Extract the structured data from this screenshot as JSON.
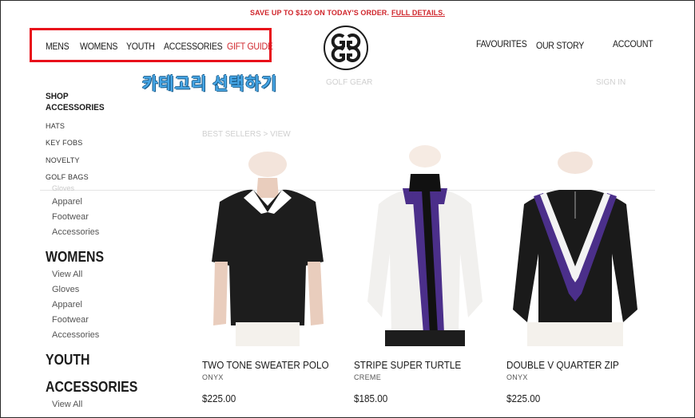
{
  "promo": {
    "text": "SAVE UP TO $120 ON TODAY'S ORDER.",
    "link": "FULL DETAILS."
  },
  "nav": {
    "left": [
      "MENS",
      "WOMENS",
      "YOUTH",
      "ACCESSORIES",
      "GIFT GUIDE"
    ],
    "right": [
      "FAVOURITES",
      "OUR STORY",
      "ACCOUNT"
    ]
  },
  "logo": {
    "icon": "brand-logo-icon"
  },
  "annotation": "카테고리 선택하기",
  "faded": {
    "center": "GOLF GEAR",
    "right": "SIGN IN",
    "crumb": "BEST SELLERS   >   VIEW"
  },
  "dropdown": {
    "title_line1": "SHOP",
    "title_line2": "ACCESSORIES",
    "items": [
      "HATS",
      "KEY FOBS",
      "NOVELTY",
      "GOLF BAGS"
    ]
  },
  "sidebar": {
    "partial": "Gloves",
    "top_links": [
      "Apparel",
      "Footwear",
      "Accessories"
    ],
    "womens": {
      "heading": "WOMENS",
      "links": [
        "View All",
        "Gloves",
        "Apparel",
        "Footwear",
        "Accessories"
      ]
    },
    "youth": {
      "heading": "YOUTH"
    },
    "accessories": {
      "heading": "ACCESSORIES",
      "links": [
        "View All"
      ]
    }
  },
  "products": [
    {
      "name": "TWO TONE SWEATER POLO",
      "color": "ONYX",
      "price": "$225.00"
    },
    {
      "name": "STRIPE SUPER TURTLE",
      "color": "CREME",
      "price": "$185.00"
    },
    {
      "name": "DOUBLE V QUARTER ZIP",
      "color": "ONYX",
      "price": "$225.00"
    }
  ],
  "colors": {
    "accent_red": "#d0262c",
    "highlight_red": "#e8101a",
    "annotation_blue": "#46a6e6"
  }
}
